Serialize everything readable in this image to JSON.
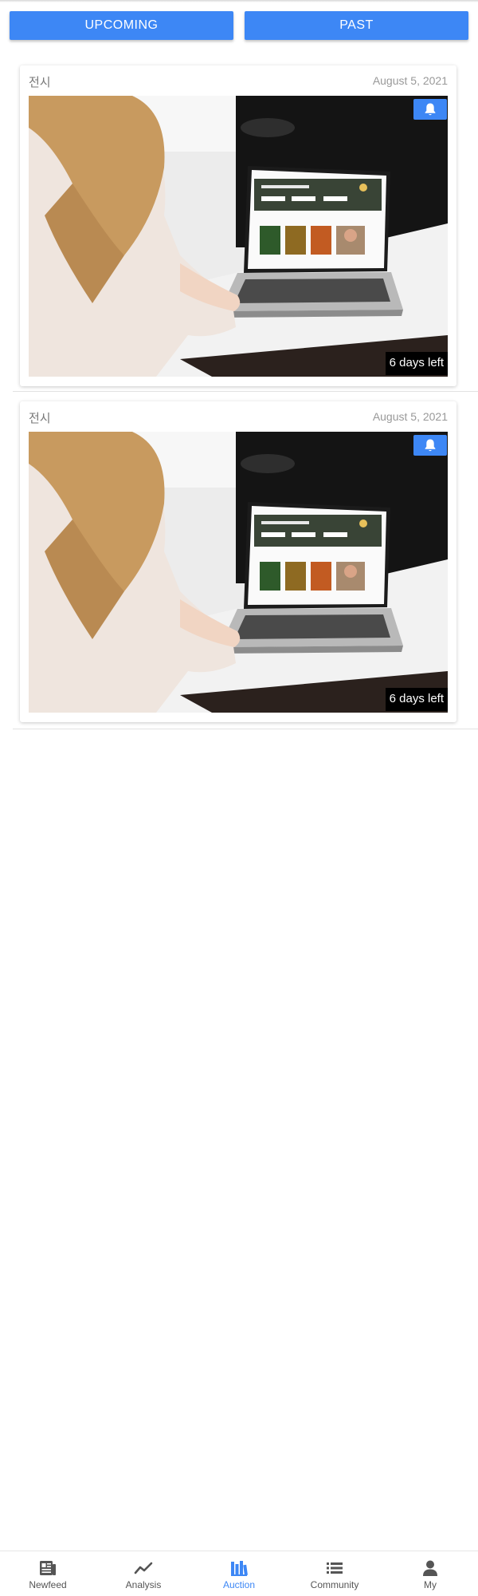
{
  "tabs": {
    "upcoming_label": "UPCOMING",
    "past_label": "PAST"
  },
  "cards": [
    {
      "category": "전시",
      "date": "August 5, 2021",
      "days_left": "6 days left",
      "image_icon": "laptop-woman-photo",
      "bell_icon": "bell-icon"
    },
    {
      "category": "전시",
      "date": "August 5, 2021",
      "days_left": "6 days left",
      "image_icon": "laptop-woman-photo",
      "bell_icon": "bell-icon"
    }
  ],
  "bottom_nav": {
    "items": [
      {
        "label": "Newfeed",
        "icon": "newspaper-icon",
        "active": false
      },
      {
        "label": "Analysis",
        "icon": "trending-line-icon",
        "active": false
      },
      {
        "label": "Auction",
        "icon": "books-icon",
        "active": true
      },
      {
        "label": "Community",
        "icon": "list-icon",
        "active": false
      },
      {
        "label": "My",
        "icon": "person-icon",
        "active": false
      }
    ]
  },
  "colors": {
    "accent": "#3d87f5",
    "badge_bg": "#000000",
    "inactive_nav": "#555555"
  }
}
